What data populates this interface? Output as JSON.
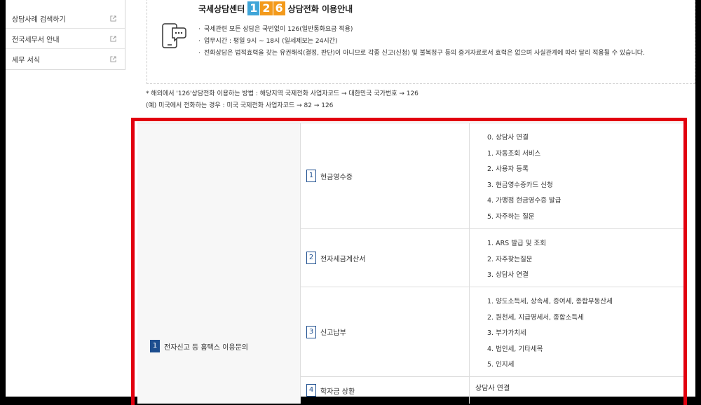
{
  "sidebar": {
    "items": [
      {
        "label": "상담사례 검색하기"
      },
      {
        "label": "전국세무서 안내"
      },
      {
        "label": "세무 서식"
      }
    ]
  },
  "info": {
    "title_prefix": "국세상담센터",
    "number_digits": [
      "1",
      "2",
      "6"
    ],
    "title_suffix": "상담전화 이용안내",
    "bullets": [
      "국세관련 모든 상담은 국번없이 126(일반통화요금 적용)",
      "업무시간 : 평일 9시 ~ 18시 (일세제보는 24시간)",
      "전화상담은 법적효력을 갖는 유권해석(결정, 판단)이 아니므로 각종 신고(신청) 및 불복청구 등의 증거자료로서 효력은 없으며 사실관계에 따라 달리 적용될 수 있습니다."
    ]
  },
  "notes": [
    "* 해외에서 '126'상담전화 이용하는 방법 : 해당지역 국제전화 사업자코드 → 대한민국 국가번호 → 126",
    "(예) 미국에서 전화하는 경우 : 미국 국제전화 사업자코드 → 82 → 126"
  ],
  "table": {
    "category": {
      "num": "1",
      "label": "전자신고 등 홈택스 이용문의"
    },
    "rows": [
      {
        "num": "1",
        "label": "현금영수증",
        "options": [
          "0. 상담사 연결",
          "1. 자동조회 서비스",
          "2. 사용자 등록",
          "3. 현금영수증카드 신청",
          "4. 가맹점 현금영수증 발급",
          "5. 자주하는 질문"
        ]
      },
      {
        "num": "2",
        "label": "전자세금계산서",
        "options": [
          "1. ARS 발급 및 조회",
          "2. 자주찾는질문",
          "3. 상담사 연결"
        ]
      },
      {
        "num": "3",
        "label": "신고납부",
        "options": [
          "1. 양도소득세, 상속세, 증여세, 종합부동산세",
          "2. 원천세, 지급명세서, 종합소득세",
          "3. 부가가치세",
          "4. 법인세, 기타세목",
          "5. 인지세"
        ]
      },
      {
        "num": "4",
        "label": "학자금 상환",
        "options": [
          "상담사 연결"
        ]
      }
    ]
  }
}
